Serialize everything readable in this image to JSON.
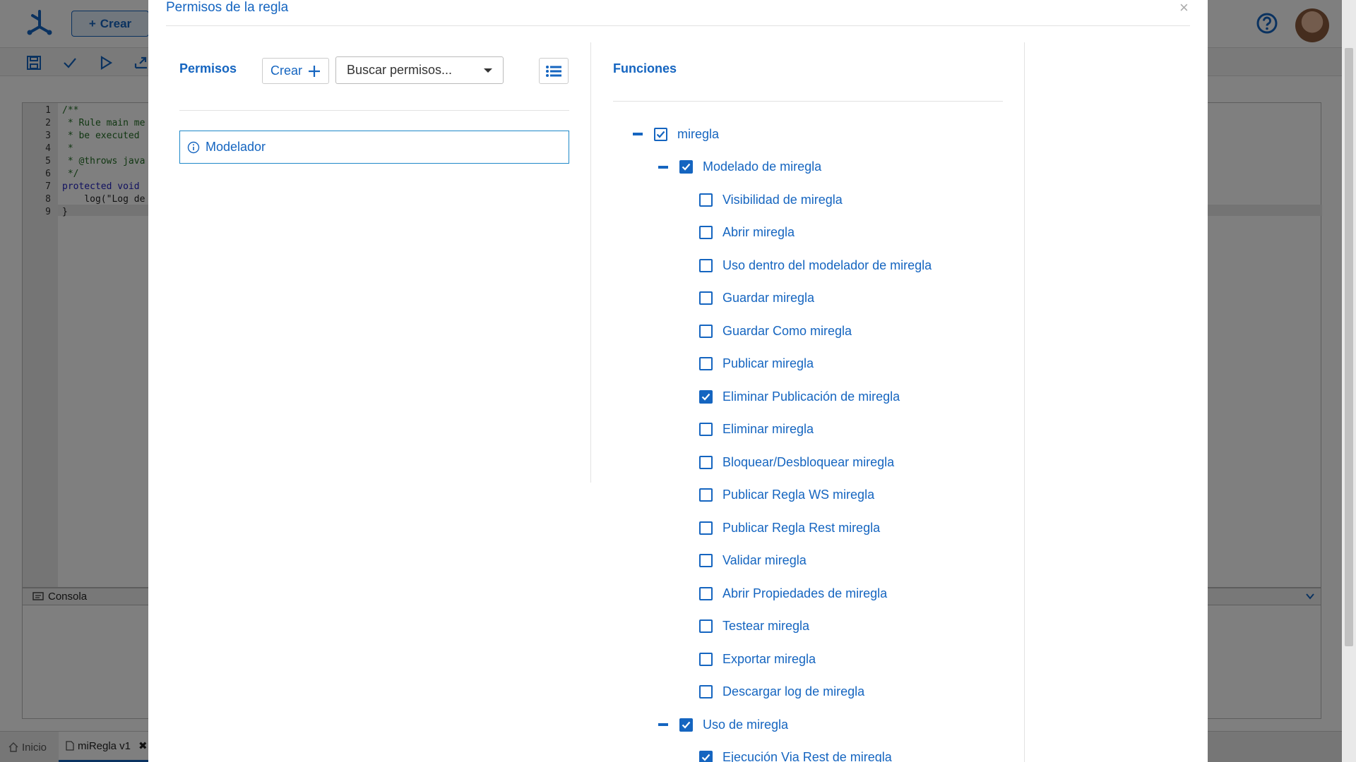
{
  "background": {
    "top_button_label": "Crear",
    "console_label": "Consola",
    "code_lines": [
      {
        "num": "1",
        "text": "/**",
        "cls": "c-com"
      },
      {
        "num": "2",
        "text": " * Rule main me",
        "cls": "c-com"
      },
      {
        "num": "3",
        "text": " * be executed",
        "cls": "c-com"
      },
      {
        "num": "4",
        "text": " *",
        "cls": "c-com"
      },
      {
        "num": "5",
        "text": " * @throws java",
        "cls": "c-com"
      },
      {
        "num": "6",
        "text": " */",
        "cls": "c-com"
      },
      {
        "num": "7",
        "text": "protected void",
        "cls": "c-kw"
      },
      {
        "num": "8",
        "text": "    log(\"Log de",
        "cls": ""
      },
      {
        "num": "9",
        "text": "}",
        "cls": ""
      }
    ],
    "tabs": {
      "home": "Inicio",
      "rule": "miRegla v1"
    }
  },
  "modal": {
    "title": "Permisos de la regla",
    "close_glyph": "×",
    "permisos": {
      "title": "Permisos",
      "create_label": "Crear",
      "search_placeholder": "Buscar permisos...",
      "items": [
        "Modelador"
      ]
    },
    "funciones": {
      "title": "Funciones",
      "tree": [
        {
          "label": "miregla",
          "level": 0,
          "state": "checked",
          "collapsible": true
        },
        {
          "label": "Modelado de miregla",
          "level": 1,
          "state": "checked",
          "collapsible": true
        },
        {
          "label": "Visibilidad de miregla",
          "level": 2,
          "state": "unchecked"
        },
        {
          "label": "Abrir miregla",
          "level": 2,
          "state": "unchecked"
        },
        {
          "label": "Uso dentro del modelador de miregla",
          "level": 2,
          "state": "unchecked"
        },
        {
          "label": "Guardar miregla",
          "level": 2,
          "state": "unchecked"
        },
        {
          "label": "Guardar Como miregla",
          "level": 2,
          "state": "unchecked"
        },
        {
          "label": "Publicar miregla",
          "level": 2,
          "state": "unchecked"
        },
        {
          "label": "Eliminar Publicación de miregla",
          "level": 2,
          "state": "checked"
        },
        {
          "label": "Eliminar miregla",
          "level": 2,
          "state": "unchecked"
        },
        {
          "label": "Bloquear/Desbloquear miregla",
          "level": 2,
          "state": "unchecked"
        },
        {
          "label": "Publicar Regla WS miregla",
          "level": 2,
          "state": "unchecked"
        },
        {
          "label": "Publicar Regla Rest miregla",
          "level": 2,
          "state": "unchecked"
        },
        {
          "label": "Validar miregla",
          "level": 2,
          "state": "unchecked"
        },
        {
          "label": "Abrir Propiedades de miregla",
          "level": 2,
          "state": "unchecked"
        },
        {
          "label": "Testear miregla",
          "level": 2,
          "state": "unchecked"
        },
        {
          "label": "Exportar miregla",
          "level": 2,
          "state": "unchecked"
        },
        {
          "label": "Descargar log de miregla",
          "level": 2,
          "state": "unchecked"
        },
        {
          "label": "Uso de miregla",
          "level": 1,
          "state": "checked",
          "collapsible": true
        },
        {
          "label": "Ejecución Via Rest de miregla",
          "level": 2,
          "state": "checked"
        }
      ]
    }
  },
  "colors": {
    "accent": "#1565c0",
    "overlay": "rgba(0,0,0,0.5)"
  }
}
